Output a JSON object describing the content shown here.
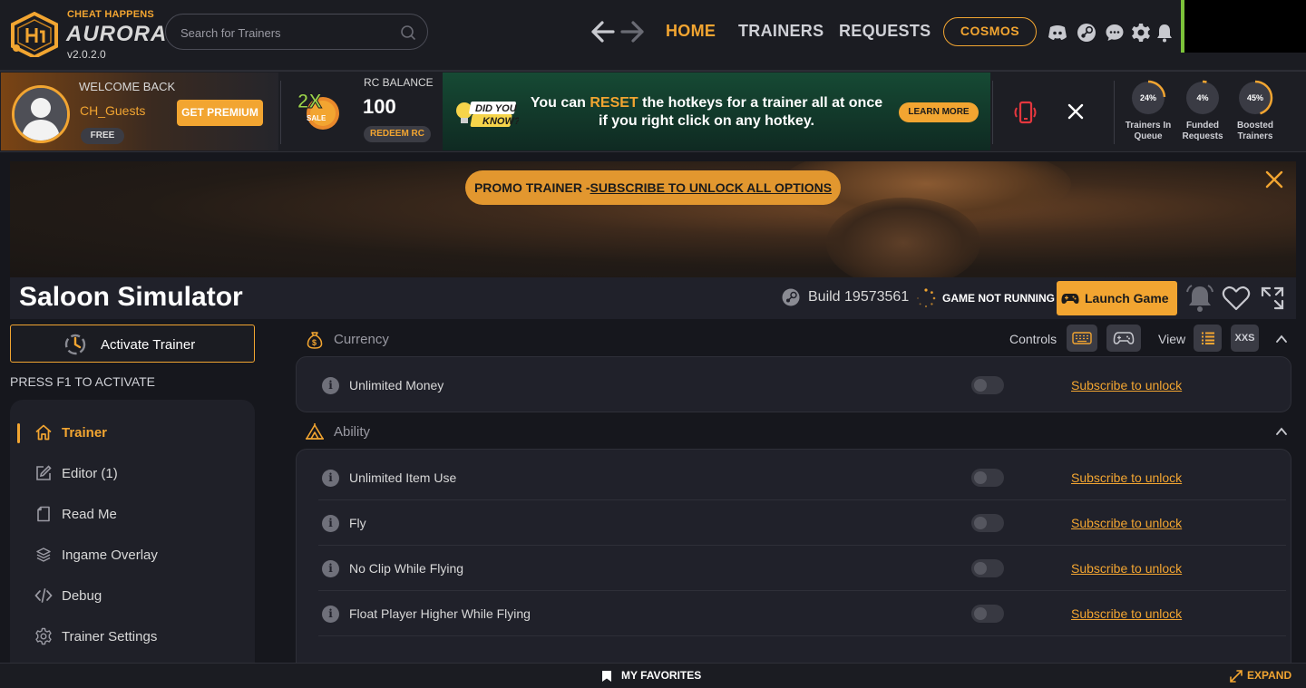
{
  "app": {
    "brand_top": "CHEAT HAPPENS",
    "brand_name": "AURORA",
    "version": "v2.0.2.0"
  },
  "search": {
    "placeholder": "Search for Trainers"
  },
  "nav": {
    "home": "HOME",
    "trainers": "TRAINERS",
    "requests": "REQUESTS",
    "cosmos": "COSMOS"
  },
  "user": {
    "welcome": "WELCOME BACK",
    "name": "CH_Guests",
    "tier": "FREE",
    "premium_btn": "GET PREMIUM"
  },
  "sale": {
    "multiplier": "2X",
    "label": "SALE"
  },
  "rc": {
    "label": "RC BALANCE",
    "value": "100",
    "redeem_btn": "REDEEM RC"
  },
  "tip": {
    "badge_line1": "DID YOU",
    "badge_line2": "KNOW?",
    "pre": "You can ",
    "highlight": "RESET",
    "post": " the hotkeys for a trainer all at once if you right click on any hotkey.",
    "learn_btn": "LEARN MORE"
  },
  "stats": [
    {
      "percent": "24%",
      "value": 0.24,
      "label1": "Trainers In",
      "label2": "Queue"
    },
    {
      "percent": "4%",
      "value": 0.04,
      "label1": "Funded",
      "label2": "Requests"
    },
    {
      "percent": "45%",
      "value": 0.45,
      "label1": "Boosted",
      "label2": "Trainers"
    }
  ],
  "promo": {
    "prefix": "PROMO TRAINER -",
    "link": "SUBSCRIBE TO UNLOCK ALL OPTIONS"
  },
  "game": {
    "title": "Saloon Simulator",
    "build": "Build 19573561",
    "status": "GAME NOT RUNNING",
    "launch_btn": "Launch Game"
  },
  "trainer": {
    "activate_btn": "Activate Trainer",
    "hint": "PRESS F1 TO ACTIVATE"
  },
  "menu": [
    {
      "label": "Trainer",
      "icon": "home-icon"
    },
    {
      "label": "Editor (1)",
      "icon": "edit-icon"
    },
    {
      "label": "Read Me",
      "icon": "document-icon"
    },
    {
      "label": "Ingame Overlay",
      "icon": "layers-icon"
    },
    {
      "label": "Debug",
      "icon": "code-icon"
    },
    {
      "label": "Trainer Settings",
      "icon": "gear-icon"
    }
  ],
  "toolbar": {
    "controls_label": "Controls",
    "view_label": "View",
    "xxs_label": "XXS"
  },
  "sections": [
    {
      "title": "Currency",
      "icon": "money-bag-icon",
      "cheats": [
        {
          "label": "Unlimited Money",
          "action": "Subscribe to unlock",
          "enabled": false
        }
      ]
    },
    {
      "title": "Ability",
      "icon": "tent-icon",
      "cheats": [
        {
          "label": "Unlimited Item Use",
          "action": "Subscribe to unlock",
          "enabled": false
        },
        {
          "label": "Fly",
          "action": "Subscribe to unlock",
          "enabled": false
        },
        {
          "label": "No Clip While Flying",
          "action": "Subscribe to unlock",
          "enabled": false
        },
        {
          "label": "Float Player Higher While Flying",
          "action": "Subscribe to unlock",
          "enabled": false
        }
      ]
    }
  ],
  "bottom": {
    "favorites": "MY FAVORITES",
    "expand": "EXPAND"
  },
  "colors": {
    "accent": "#f2a531",
    "background": "#16171d",
    "panel": "#20212a",
    "tip_green": "#164a34",
    "status_green": "#7cc33a",
    "danger_red": "#e5373e"
  }
}
